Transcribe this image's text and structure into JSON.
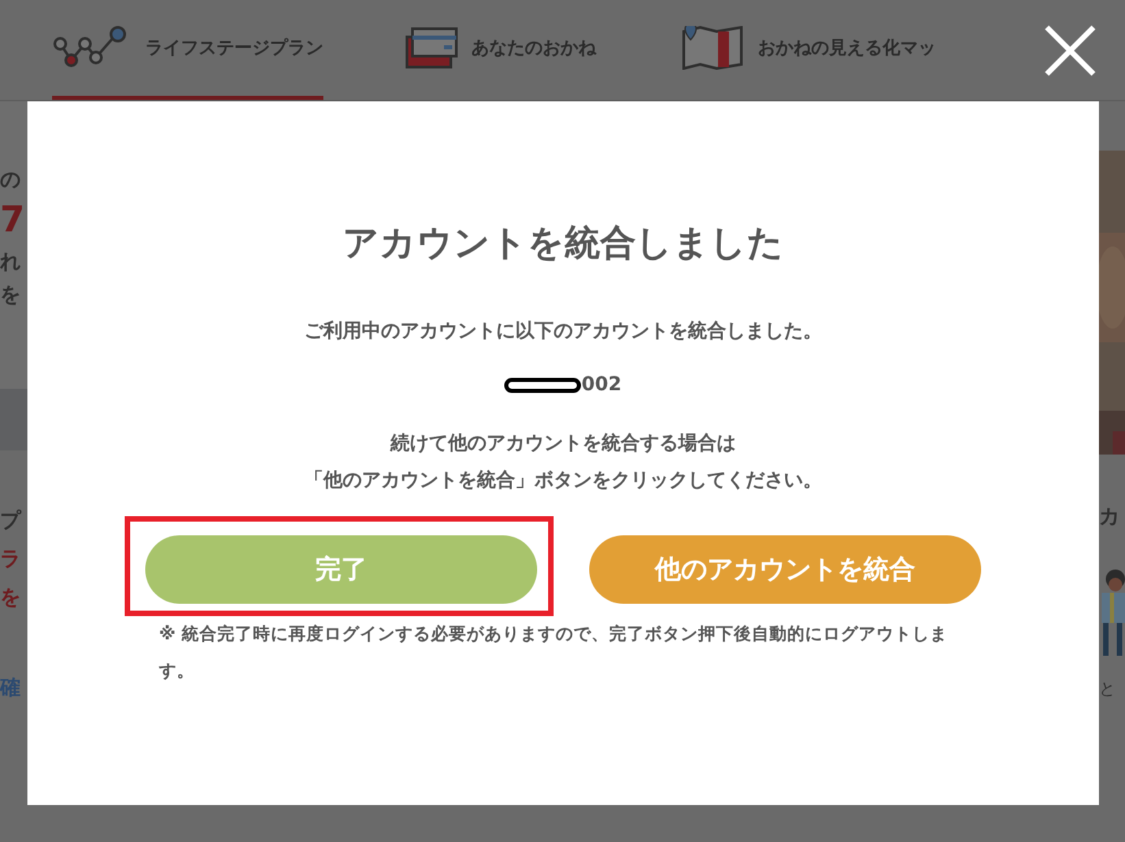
{
  "header": {
    "tabs": [
      {
        "label": "ライフステージプラン",
        "selected": true
      },
      {
        "label": "あなたのおかね",
        "selected": false
      },
      {
        "label": "おかねの見える化マッ",
        "selected": false
      }
    ]
  },
  "background": {
    "left_fragments": [
      "の",
      "7",
      "れ",
      "を"
    ],
    "left_lower_fragments": [
      "プ",
      "ラ",
      "を"
    ],
    "left_link": "確",
    "right_heading": "カ",
    "right_text": "と"
  },
  "dialog": {
    "title": "アカウントを統合しました",
    "message": "ご利用中のアカウントに以下のアカウントを統合しました。",
    "account_id": "002",
    "instruction_lines": [
      "続けて他のアカウントを統合する場合は",
      "「他のアカウントを統合」ボタンをクリックしてください。"
    ],
    "buttons": [
      {
        "label": "完了",
        "kind": "primary",
        "highlighted": true
      },
      {
        "label": "他のアカウントを統合",
        "kind": "secondary",
        "highlighted": false
      }
    ],
    "note": "※ 統合完了時に再度ログインする必要がありますので、完了ボタン押下後自動的にログアウトします。"
  }
}
